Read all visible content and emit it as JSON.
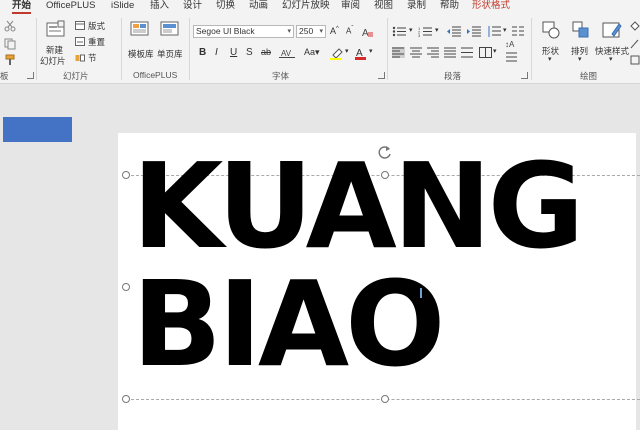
{
  "tabs": [
    {
      "label": "开始",
      "active": true
    },
    {
      "label": "OfficePLUS"
    },
    {
      "label": "iSlide"
    },
    {
      "label": "插入"
    },
    {
      "label": "设计"
    },
    {
      "label": "切换"
    },
    {
      "label": "动画"
    },
    {
      "label": "幻灯片放映"
    },
    {
      "label": "审阅"
    },
    {
      "label": "视图"
    },
    {
      "label": "录制"
    },
    {
      "label": "帮助"
    },
    {
      "label": "形状格式",
      "contextual": true
    }
  ],
  "ribbon": {
    "clipboard": {
      "label": "板"
    },
    "slides": {
      "label": "幻灯片",
      "new_slide_line1": "新建",
      "new_slide_line2": "幻灯片",
      "layout": "版式",
      "reset": "重置",
      "section": "节"
    },
    "officeplus": {
      "label": "OfficePLUS",
      "template_lib": "模板库",
      "single_page_lib": "单页库"
    },
    "font": {
      "label": "字体",
      "font_name": "Segoe UI Black",
      "font_size": "250"
    },
    "paragraph": {
      "label": "段落"
    },
    "drawing": {
      "label": "绘图",
      "shape": "形状",
      "arrange": "排列",
      "quick_styles": "快速样式"
    }
  },
  "slide": {
    "line1": "KUANG",
    "line2": "BIAO"
  },
  "colors": {
    "accent_tab": "#c0392b",
    "blue_shape": "#4472c4"
  }
}
